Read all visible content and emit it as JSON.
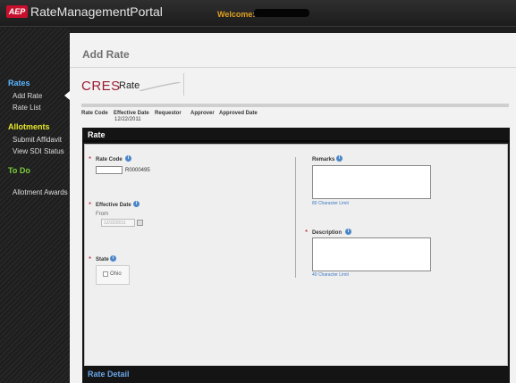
{
  "header": {
    "logo": "AEP",
    "title": "RateManagementPortal",
    "welcome_label": "Welcome:"
  },
  "sidebar": {
    "sections": [
      {
        "title": "Rates",
        "color": "#5ab4ff",
        "items": [
          "Add Rate",
          "Rate List"
        ]
      },
      {
        "title": "Allotments",
        "color": "#e8e82a",
        "items": [
          "Submit Affidavit",
          "View SDI Status"
        ]
      },
      {
        "title": "To Do",
        "color": "#7ccf3c",
        "items": [
          "Allotment Awards"
        ]
      }
    ]
  },
  "main": {
    "page_title": "Add Rate",
    "brand": {
      "primary": "CRES",
      "secondary": "Rate"
    },
    "meta": {
      "headers": [
        "Rate Code",
        "Effective Date",
        "Requestor",
        "Approver",
        "Approved Date"
      ],
      "effective_date": "12/22/2011"
    },
    "panel": {
      "title": "Rate",
      "footer_title": "Rate Detail",
      "rate_code": {
        "label": "Rate Code",
        "value": "",
        "suffix": "R0000495"
      },
      "effective_date": {
        "label": "Effective Date",
        "from_label": "From",
        "value": "12/22/2011"
      },
      "state": {
        "label": "State",
        "option": "Ohio"
      },
      "remarks": {
        "label": "Remarks",
        "limit": "80 Character Limit"
      },
      "description": {
        "label": "Description",
        "limit": "40 Character Limit"
      },
      "info_glyph": "i",
      "required_glyph": "*"
    }
  },
  "colors": {
    "accent": "#c8102e",
    "welcome": "#e0a020",
    "link": "#3a78c0"
  }
}
